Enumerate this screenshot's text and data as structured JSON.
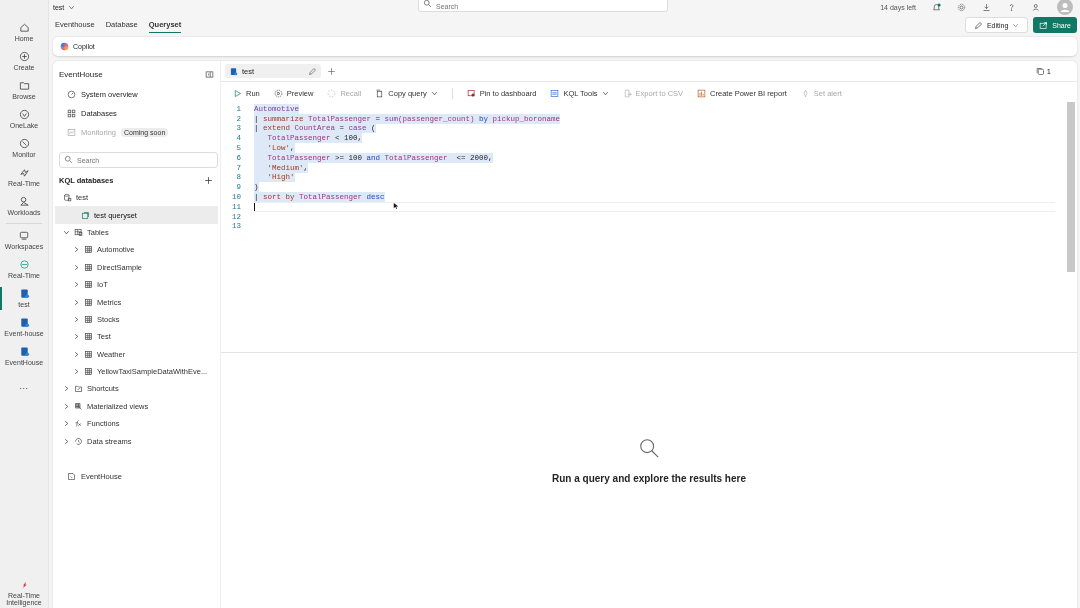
{
  "topbar": {
    "workspace": "test",
    "search": {
      "placeholder": "Search"
    },
    "trial": "14 days left"
  },
  "rail": [
    {
      "label": "Home",
      "kind": "home",
      "selected": false
    },
    {
      "label": "Create",
      "kind": "create",
      "selected": false
    },
    {
      "label": "Browse",
      "kind": "browse",
      "selected": false
    },
    {
      "label": "OneLake",
      "kind": "onelake",
      "selected": false
    },
    {
      "label": "Monitor",
      "kind": "monitor",
      "selected": false
    },
    {
      "label": "Real-Time",
      "kind": "realtime",
      "selected": false
    },
    {
      "label": "Workloads",
      "kind": "workloads",
      "selected": false
    },
    {
      "label": "Workspaces",
      "kind": "workspaces",
      "selected": false
    },
    {
      "label": "Real-Time",
      "kind": "rtworkspace",
      "selected": false
    },
    {
      "label": "test",
      "kind": "item",
      "selected": true
    },
    {
      "label": "Event-house",
      "kind": "item",
      "selected": false
    },
    {
      "label": "EventHouse",
      "kind": "item",
      "selected": false
    },
    {
      "label": "...",
      "kind": "more",
      "selected": false
    }
  ],
  "rail_footer": {
    "label": "Real-Time Intelligence"
  },
  "tabs": [
    {
      "label": "Eventhouse",
      "selected": false
    },
    {
      "label": "Database",
      "selected": false
    },
    {
      "label": "Queryset",
      "selected": true
    }
  ],
  "actions": {
    "editing": "Editing",
    "share": "Share"
  },
  "copilot": {
    "label": "Copilot"
  },
  "explorer": {
    "title": "EventHouse",
    "nav": [
      {
        "label": "System overview",
        "kind": "overview",
        "disabled": false
      },
      {
        "label": "Databases",
        "kind": "databases",
        "disabled": false
      },
      {
        "label": "Monitoring",
        "kind": "monitoring",
        "disabled": true,
        "badge": "Coming soon"
      }
    ],
    "search": {
      "placeholder": "Search"
    },
    "section": "KQL databases",
    "tree": [
      {
        "label": "test",
        "kind": "database",
        "selected": false,
        "children": [
          {
            "label": "test queryset",
            "kind": "queryset",
            "selected": true
          },
          {
            "label": "Tables",
            "kind": "tables",
            "selected": false,
            "expanded": true,
            "children": [
              {
                "label": "Automotive",
                "kind": "table",
                "selected": false,
                "expanded": false
              },
              {
                "label": "DirectSample",
                "kind": "table",
                "selected": false,
                "expanded": false
              },
              {
                "label": "IoT",
                "kind": "table",
                "selected": false,
                "expanded": false
              },
              {
                "label": "Metrics",
                "kind": "table",
                "selected": false,
                "expanded": false
              },
              {
                "label": "Stocks",
                "kind": "table",
                "selected": false,
                "expanded": false
              },
              {
                "label": "Test",
                "kind": "table",
                "selected": false,
                "expanded": false
              },
              {
                "label": "Weather",
                "kind": "table",
                "selected": false,
                "expanded": false
              },
              {
                "label": "YellowTaxiSampleDataWithEve...",
                "kind": "table",
                "selected": false,
                "expanded": false
              }
            ]
          },
          {
            "label": "Shortcuts",
            "kind": "shortcut",
            "selected": false,
            "expanded": false
          },
          {
            "label": "Materialized views",
            "kind": "matview",
            "selected": false,
            "expanded": false
          },
          {
            "label": "Functions",
            "kind": "function",
            "selected": false,
            "expanded": false
          },
          {
            "label": "Data streams",
            "kind": "stream",
            "selected": false,
            "expanded": false
          }
        ]
      }
    ],
    "footer_item": {
      "label": "EventHouse"
    }
  },
  "editor": {
    "tab": {
      "label": "test",
      "selected": true
    },
    "tab_count": "1",
    "toolbar": [
      [
        {
          "label": "Run",
          "kind": "run",
          "disabled": false,
          "dropdown": false
        },
        {
          "label": "Preview",
          "kind": "preview",
          "disabled": false,
          "dropdown": false
        },
        {
          "label": "Recall",
          "kind": "recall",
          "disabled": true,
          "dropdown": false
        },
        {
          "label": "Copy query",
          "kind": "copy",
          "disabled": false,
          "dropdown": true
        }
      ],
      [
        {
          "label": "Pin to dashboard",
          "kind": "pin",
          "disabled": false,
          "dropdown": false
        },
        {
          "label": "KQL Tools",
          "kind": "tools",
          "disabled": false,
          "dropdown": true
        },
        {
          "label": "Export to CSV",
          "kind": "export",
          "disabled": true,
          "dropdown": false
        },
        {
          "label": "Create Power BI report",
          "kind": "report",
          "disabled": false,
          "dropdown": false
        },
        {
          "label": "Set alert",
          "kind": "alert",
          "disabled": true,
          "dropdown": false
        }
      ]
    ],
    "lines": [
      {
        "number": "1",
        "selected": true,
        "current": false,
        "tokens": [
          {
            "text": "Automotive",
            "kind": "table"
          }
        ]
      },
      {
        "number": "2",
        "selected": true,
        "current": false,
        "tokens": [
          {
            "text": "| ",
            "kind": "op"
          },
          {
            "text": "summarize",
            "kind": "keyword"
          },
          {
            "text": " TotalPassenger",
            "kind": "column"
          },
          {
            "text": " = ",
            "kind": "op"
          },
          {
            "text": "sum",
            "kind": "function"
          },
          {
            "text": "(passenger_count) ",
            "kind": "column"
          },
          {
            "text": "by",
            "kind": "word"
          },
          {
            "text": " pickup_boroname",
            "kind": "column"
          }
        ]
      },
      {
        "number": "3",
        "selected": true,
        "current": false,
        "tokens": [
          {
            "text": "| ",
            "kind": "op"
          },
          {
            "text": "extend",
            "kind": "keyword"
          },
          {
            "text": " CountArea",
            "kind": "column"
          },
          {
            "text": " = ",
            "kind": "op"
          },
          {
            "text": "case",
            "kind": "function"
          },
          {
            "text": " (",
            "kind": "op"
          }
        ]
      },
      {
        "number": "4",
        "selected": true,
        "current": false,
        "tokens": [
          {
            "text": "   TotalPassenger",
            "kind": "column"
          },
          {
            "text": " < 100,",
            "kind": "op"
          }
        ]
      },
      {
        "number": "5",
        "selected": true,
        "current": false,
        "tokens": [
          {
            "text": "   'Low'",
            "kind": "string"
          },
          {
            "text": ",",
            "kind": "op"
          }
        ]
      },
      {
        "number": "6",
        "selected": true,
        "current": false,
        "tokens": [
          {
            "text": "   TotalPassenger",
            "kind": "column"
          },
          {
            "text": " >= 100 ",
            "kind": "op"
          },
          {
            "text": "and",
            "kind": "word"
          },
          {
            "text": " TotalPassenger",
            "kind": "column"
          },
          {
            "text": "  <= 2000,",
            "kind": "op"
          }
        ]
      },
      {
        "number": "7",
        "selected": true,
        "current": false,
        "tokens": [
          {
            "text": "   'Medium'",
            "kind": "string"
          },
          {
            "text": ",",
            "kind": "op"
          }
        ]
      },
      {
        "number": "8",
        "selected": true,
        "current": false,
        "tokens": [
          {
            "text": "   'High'",
            "kind": "string"
          }
        ]
      },
      {
        "number": "9",
        "selected": true,
        "current": false,
        "tokens": [
          {
            "text": ")",
            "kind": "op"
          }
        ]
      },
      {
        "number": "10",
        "selected": true,
        "current": false,
        "tokens": [
          {
            "text": "| ",
            "kind": "op"
          },
          {
            "text": "sort by",
            "kind": "keyword"
          },
          {
            "text": " TotalPassenger ",
            "kind": "column"
          },
          {
            "text": "desc",
            "kind": "word"
          }
        ]
      },
      {
        "number": "11",
        "selected": false,
        "current": true
      },
      {
        "number": "12",
        "selected": false,
        "current": false
      },
      {
        "number": "13",
        "selected": false,
        "current": false
      }
    ]
  },
  "results": {
    "message": "Run a query and explore the results here"
  }
}
